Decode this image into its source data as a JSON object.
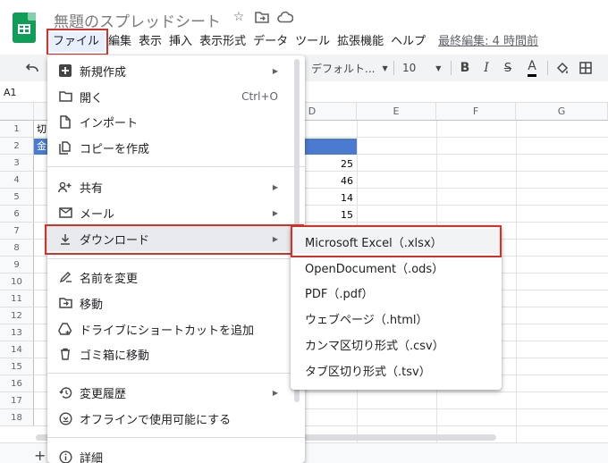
{
  "header": {
    "doc_title": "無題のスプレッドシート",
    "icons": [
      "star-icon",
      "folder-move-icon",
      "cloud-status-icon"
    ]
  },
  "menubar": {
    "items": [
      "ファイル",
      "編集",
      "表示",
      "挿入",
      "表示形式",
      "データ",
      "ツール",
      "拡張機能",
      "ヘルプ"
    ],
    "last_edit": "最終編集: 4 時間前"
  },
  "toolbar": {
    "font": "デフォルト...",
    "font_size": "10",
    "bold": "B",
    "italic": "I",
    "strike": "S",
    "text_color": "A"
  },
  "namebox": {
    "value": "A1"
  },
  "grid": {
    "columns": [
      "D",
      "E",
      "F",
      "G"
    ],
    "rows": [
      "1",
      "2",
      "3",
      "4",
      "5",
      "6",
      "7",
      "8",
      "9",
      "10",
      "11",
      "12",
      "13",
      "14",
      "15",
      "16",
      "17",
      "18"
    ],
    "cells": {
      "a1": "切",
      "a2": "金",
      "d3": "25",
      "d4": "46",
      "d5": "14",
      "d6": "15"
    },
    "accent": "#4a7bd0"
  },
  "file_menu": {
    "items": [
      {
        "label": "新規作成",
        "icon": "add-box-icon",
        "arrow": true
      },
      {
        "label": "開く",
        "icon": "folder-icon",
        "shortcut": "Ctrl+O"
      },
      {
        "label": "インポート",
        "icon": "file-icon"
      },
      {
        "label": "コピーを作成",
        "icon": "copy-icon"
      },
      {
        "label": "共有",
        "icon": "person-add-icon",
        "arrow": true
      },
      {
        "label": "メール",
        "icon": "mail-icon",
        "arrow": true
      },
      {
        "label": "ダウンロード",
        "icon": "download-icon",
        "arrow": true
      },
      {
        "label": "名前を変更",
        "icon": "rename-icon"
      },
      {
        "label": "移動",
        "icon": "move-folder-icon"
      },
      {
        "label": "ドライブにショートカットを追加",
        "icon": "drive-shortcut-icon"
      },
      {
        "label": "ゴミ箱に移動",
        "icon": "trash-icon"
      },
      {
        "label": "変更履歴",
        "icon": "history-icon",
        "arrow": true
      },
      {
        "label": "オフラインで使用可能にする",
        "icon": "offline-icon"
      },
      {
        "label": "詳細",
        "icon": "info-icon"
      }
    ]
  },
  "download_submenu": {
    "items": [
      "Microsoft Excel（.xlsx）",
      "OpenDocument（.ods）",
      "PDF（.pdf）",
      "ウェブページ（.html）",
      "カンマ区切り形式（.csv）",
      "タブ区切り形式（.tsv）"
    ]
  },
  "highlight_color": "#d93025"
}
